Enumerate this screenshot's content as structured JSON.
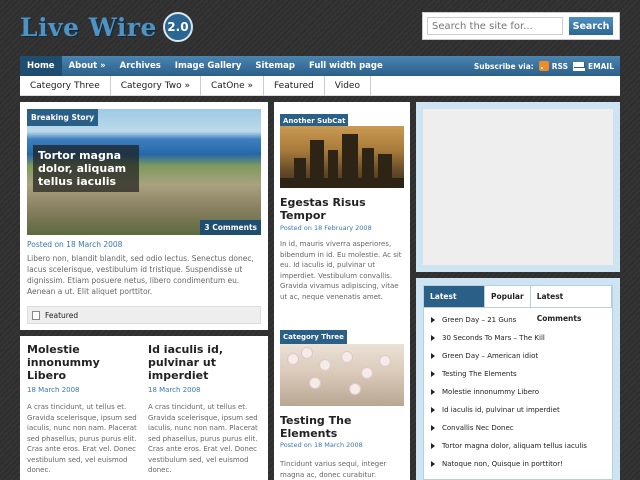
{
  "logo": {
    "name": "Live Wire",
    "version": "2.0"
  },
  "search": {
    "placeholder": "Search the site for...",
    "button": "Search"
  },
  "nav": {
    "items": [
      "Home",
      "About »",
      "Archives",
      "Image Gallery",
      "Sitemap",
      "Full width page"
    ],
    "active": "Home",
    "subscribe_label": "Subscribe via:",
    "rss": "RSS",
    "email": "EMAIL"
  },
  "categories": [
    "Category Three",
    "Category Two »",
    "CatOne »",
    "Featured",
    "Video"
  ],
  "featured": {
    "label": "Breaking Story",
    "title": "Tortor magna dolor, aliquam tellus iaculis",
    "comments": "3 Comments",
    "meta": "Posted on 18 March 2008",
    "text": "Libero non, blandit blandit, sed odio lectus. Senectus donec, lacus scelerisque, vestibulum id tristique. Suspendisse ut dignissim. Etiam posuere netus, libero condimentum eu. Aenean a ut. Elit aliquet porttitor.",
    "tag": "Featured"
  },
  "mid": [
    {
      "label": "Another SubCat",
      "title": "Egestas Risus Tempor",
      "meta": "Posted on 18 February 2008",
      "text": "In id, mauris viverra asperiores, bibendum in id. Eu molestie. Ac sit eu. Id iaculis id, pulvinar ut imperdiet. Vestibulum convallis. Gravida vivamus adipiscing, vitae ut ac, neque venenatis amet."
    },
    {
      "label": "Category Three",
      "title": "Testing The Elements",
      "meta": "Posted on 18 March 2008",
      "text": "Tincidunt varius sequi, integer magna ac, donec curabitur."
    }
  ],
  "bottom_posts": [
    {
      "title": "Molestie innonummy Libero",
      "meta": "18 March 2008",
      "text": "A cras tincidunt, ut tellus et. Gravida scelerisque, ipsum sed iaculis, nunc non nam. Placerat sed phasellus, purus purus elit. Cras ante eros. Erat vel. Donec vestibulum sed, vel euismod donec."
    },
    {
      "title": "Id iaculis id, pulvinar ut imperdiet",
      "meta": "18 March 2008",
      "text": "A cras tincidunt, ut tellus et. Gravida scelerisque, ipsum sed iaculis, nunc non nam. Placerat sed phasellus, purus purus elit. Cras ante eros. Erat vel. Donec vestibulum sed, vel euismod donec."
    }
  ],
  "tabs": {
    "labels": [
      "Latest News",
      "Popular",
      "Latest Comments"
    ],
    "active": "Latest News",
    "news": [
      "Green Day – 21 Guns",
      "30 Seconds To Mars – The Kill",
      "Green Day – American idiot",
      "Testing The Elements",
      "Molestie innonummy Libero",
      "Id iaculis id, pulvinar ut imperdiet",
      "Convallis Nec Donec",
      "Tortor magna dolor, aliquam tellus iaculis",
      "Natoque non, Quisque in porttitor!"
    ]
  },
  "colors": {
    "accent": "#2a5f88",
    "logo": "#4f93c4",
    "link": "#3a78ad",
    "background": "#2f2f2f"
  }
}
